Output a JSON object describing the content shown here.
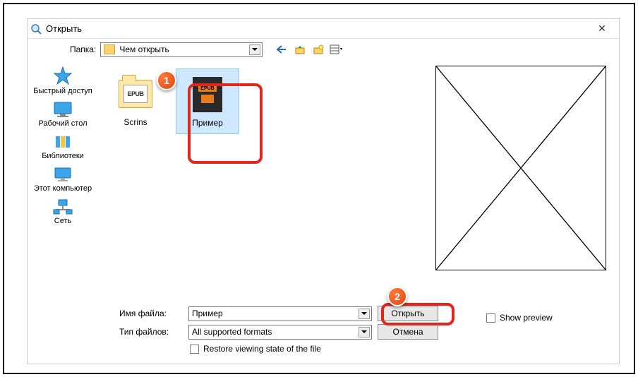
{
  "dialog": {
    "title": "Открыть",
    "folder_label": "Папка:",
    "folder_value": "Чем открыть"
  },
  "places": [
    {
      "name": "quick-access",
      "label": "Быстрый доступ"
    },
    {
      "name": "desktop",
      "label": "Рабочий стол"
    },
    {
      "name": "libraries",
      "label": "Библиотеки"
    },
    {
      "name": "this-pc",
      "label": "Этот компьютер"
    },
    {
      "name": "network",
      "label": "Сеть"
    }
  ],
  "files": [
    {
      "name": "scrins-folder",
      "label": "Scrins",
      "type": "folder",
      "selected": false
    },
    {
      "name": "primer-file",
      "label": "Пример",
      "type": "epub",
      "selected": true
    }
  ],
  "bottom": {
    "filename_label": "Имя файла:",
    "filename_value": "Пример",
    "filetype_label": "Тип файлов:",
    "filetype_value": "All supported formats",
    "open_label": "Открыть",
    "cancel_label": "Отмена",
    "restore_label": "Restore viewing state of the file",
    "show_preview_label": "Show preview"
  },
  "callouts": {
    "one": "1",
    "two": "2"
  }
}
